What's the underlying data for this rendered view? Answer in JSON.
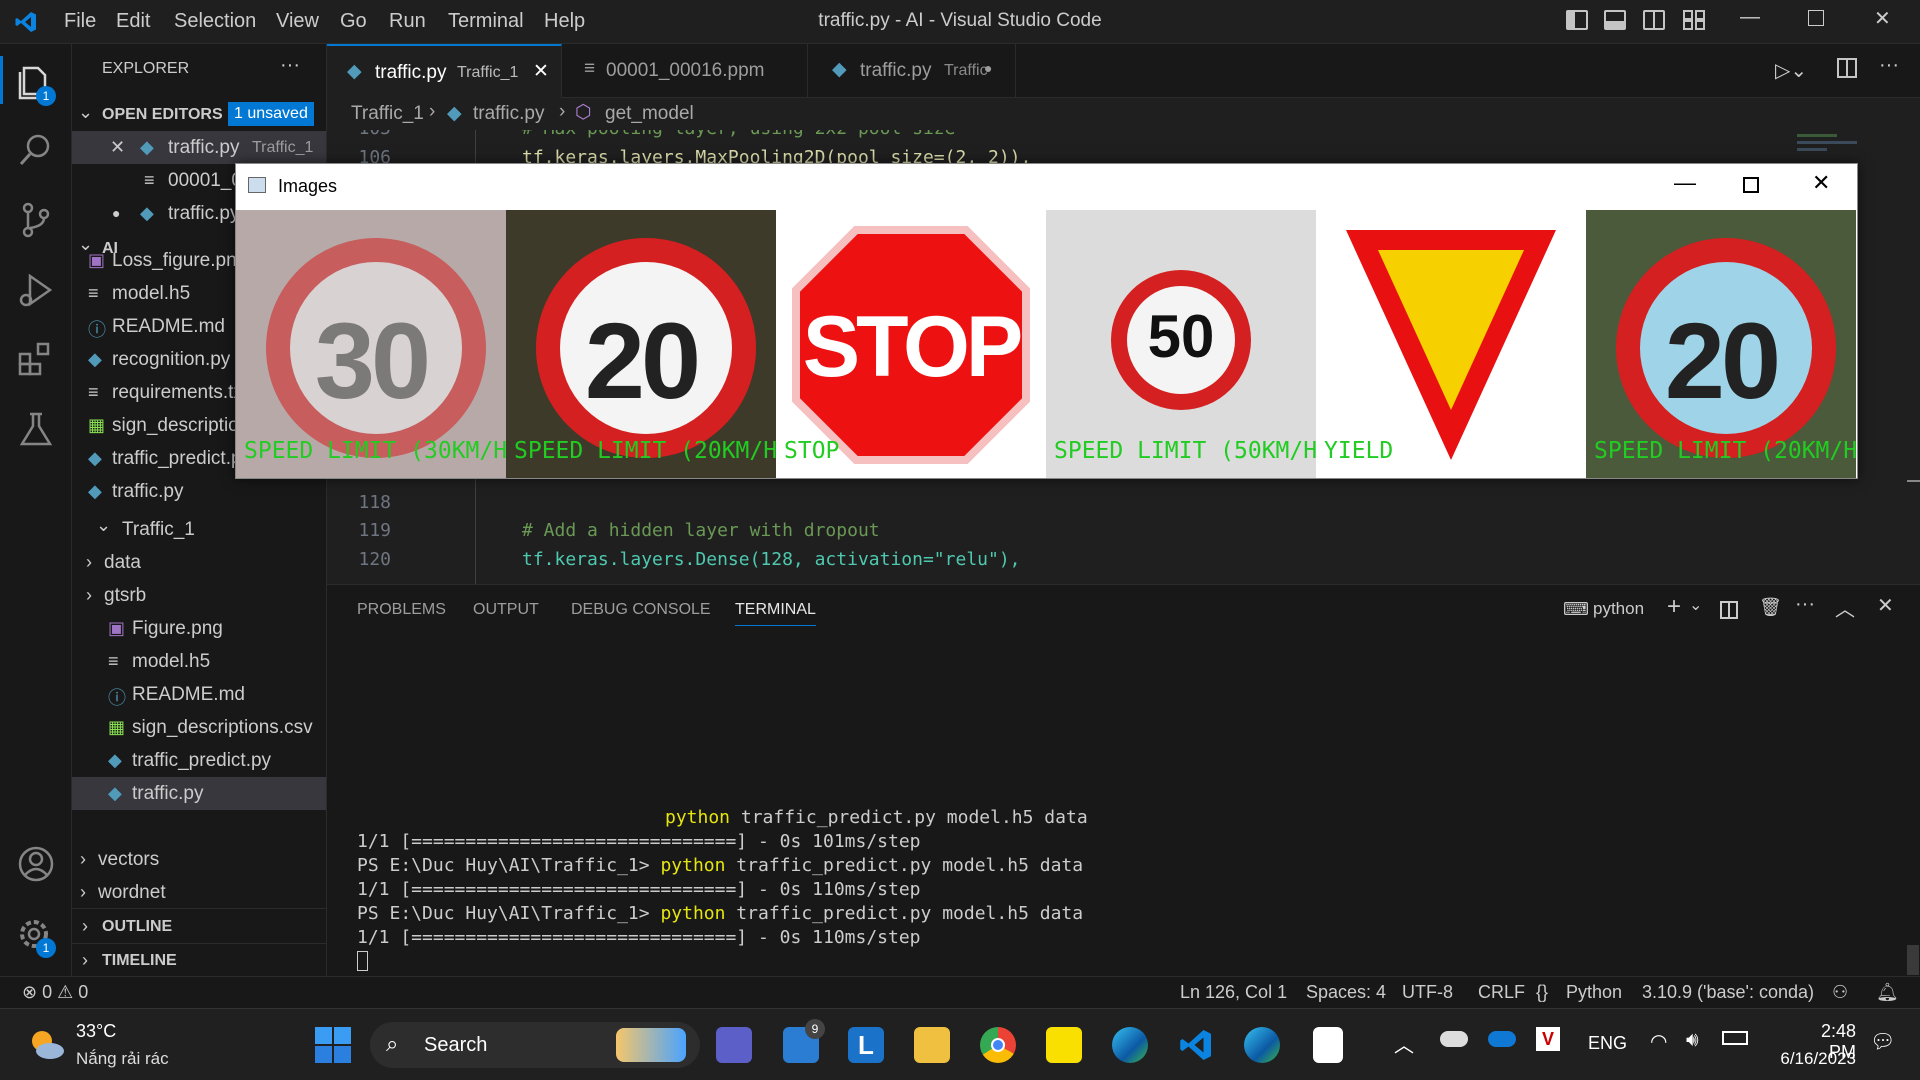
{
  "window": {
    "title": "traffic.py - AI - Visual Studio Code"
  },
  "menu": [
    "File",
    "Edit",
    "Selection",
    "View",
    "Go",
    "Run",
    "Terminal",
    "Help"
  ],
  "activity": {
    "explorer_badge": "1",
    "settings_badge": "1"
  },
  "explorer": {
    "header": "EXPLORER",
    "more": "···",
    "open_editors": {
      "label": "OPEN EDITORS",
      "badge": "1 unsaved"
    },
    "open_items": [
      {
        "name": "traffic.py",
        "desc": "Traffic_1"
      },
      {
        "name": "00001_00016.ppm",
        "desc": ""
      },
      {
        "name": "traffic.py",
        "desc": ""
      }
    ],
    "folder": "AI",
    "files_top": [
      "Loss_figure.png",
      "model.h5",
      "README.md",
      "recognition.py",
      "requirements.txt",
      "sign_descriptions.csv",
      "traffic_predict.py",
      "traffic.py"
    ],
    "subfolder": "Traffic_1",
    "sub_items": [
      "data",
      "gtsrb",
      "Figure.png",
      "model.h5",
      "README.md",
      "sign_descriptions.csv",
      "traffic_predict.py",
      "traffic.py"
    ],
    "bottom_items": [
      "vectors",
      "wordnet"
    ],
    "outline": "OUTLINE",
    "timeline": "TIMELINE"
  },
  "tabs": [
    {
      "name": "traffic.py",
      "desc": "Traffic_1",
      "close": "✕"
    },
    {
      "name": "00001_00016.ppm",
      "desc": ""
    },
    {
      "name": "traffic.py",
      "desc": "Traffic",
      "dot": "●"
    }
  ],
  "breadcrumb": [
    "Traffic_1",
    "traffic.py",
    "get_model"
  ],
  "code": {
    "top_lines": [
      {
        "n": "105",
        "text": "# Max-pooling layer, using 2x2 pool size"
      },
      {
        "n": "106",
        "text": "tf.keras.layers.MaxPooling2D(pool_size=(2, 2)),"
      }
    ],
    "bottom_lines": [
      {
        "n": "118",
        "text": ""
      },
      {
        "n": "119",
        "text": "# Add a hidden layer with dropout"
      },
      {
        "n": "120",
        "text": "tf.keras.layers.Dense(128, activation=\"relu\"),"
      }
    ]
  },
  "panel": {
    "tabs": [
      "PROBLEMS",
      "OUTPUT",
      "DEBUG CONSOLE",
      "TERMINAL"
    ],
    "shell": "python",
    "terminal": [
      {
        "prompt": "",
        "cmd": "python",
        "rest": " traffic_predict.py model.h5 data"
      },
      {
        "prompt": "1/1 [==============================] - 0s 101ms/step",
        "cmd": "",
        "rest": ""
      },
      {
        "prompt": "PS E:\\Duc Huy\\AI\\Traffic_1> ",
        "cmd": "python",
        "rest": " traffic_predict.py model.h5 data"
      },
      {
        "prompt": "1/1 [==============================] - 0s 110ms/step",
        "cmd": "",
        "rest": ""
      },
      {
        "prompt": "PS E:\\Duc Huy\\AI\\Traffic_1> ",
        "cmd": "python",
        "rest": " traffic_predict.py model.h5 data"
      },
      {
        "prompt": "1/1 [==============================] - 0s 110ms/step",
        "cmd": "",
        "rest": ""
      }
    ]
  },
  "images_window": {
    "title": "Images",
    "tiles": [
      {
        "sign": "30",
        "label": "SPEED LIMIT (30KM/H",
        "kind": "speed"
      },
      {
        "sign": "20",
        "label": "SPEED LIMIT (20KM/H",
        "kind": "speed"
      },
      {
        "sign": "STOP",
        "label": "STOP",
        "kind": "stop"
      },
      {
        "sign": "50",
        "label": "SPEED LIMIT (50KM/H",
        "kind": "speed"
      },
      {
        "sign": "",
        "label": "YIELD",
        "kind": "yield"
      },
      {
        "sign": "20",
        "label": "SPEED LIMIT (20KM/H",
        "kind": "speed"
      }
    ]
  },
  "status": {
    "errors": "0",
    "warnings": "0",
    "position": "Ln 126, Col 1",
    "spaces": "Spaces: 4",
    "encoding": "UTF-8",
    "eol": "CRLF",
    "language": "Python",
    "interpreter": "3.10.9 ('base': conda)"
  },
  "taskbar": {
    "temp": "33°C",
    "weather": "Nắng rải rác",
    "search": "Search",
    "mail_badge": "9",
    "lang": "ENG",
    "time": "2:48 PM",
    "date": "6/16/2023"
  }
}
